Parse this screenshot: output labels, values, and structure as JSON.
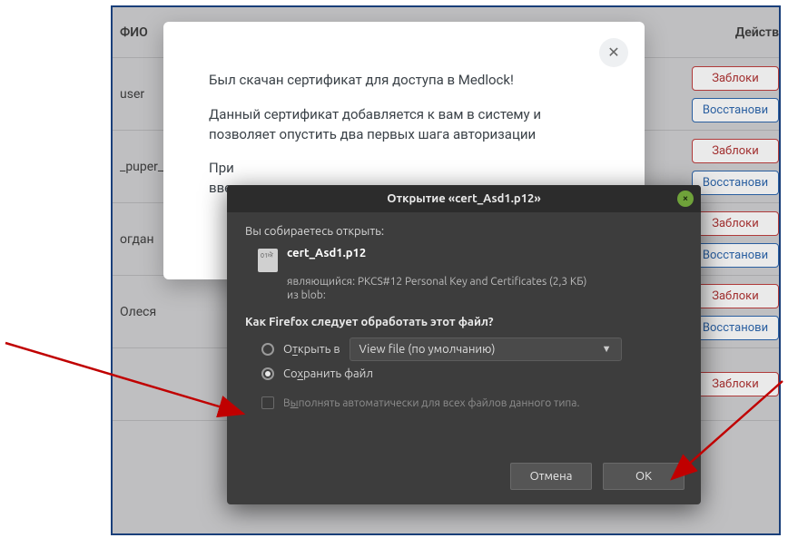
{
  "table": {
    "header_name": "ФИО",
    "header_actions": "Действ",
    "rows": [
      {
        "name": "user"
      },
      {
        "name": "_puper_"
      },
      {
        "name": "огдан"
      },
      {
        "name": "Олеся"
      }
    ],
    "block_label": "Заблоки",
    "restore_label": "Восстанови"
  },
  "modal": {
    "line1": "Был скачан сертификат для доступа в Medlock!",
    "line2": "Данный сертификат добавляется к вам в систему и позволяет опустить два первых шага авторизации",
    "line3_prefix": "При",
    "line4_prefix": "ввес"
  },
  "ff": {
    "title": "Открытие «cert_Asd1.p12»",
    "opening_label": "Вы собираетесь открыть:",
    "filename": "cert_Asd1.p12",
    "being_label": "являющийся:",
    "being_value": "PKCS#12 Personal Key and Certificates (2,3 КБ)",
    "from_label": "из",
    "from_value": "blob:",
    "question": "Как Firefox следует обработать этот файл?",
    "open_with_label_pre": "О",
    "open_with_label_u": "т",
    "open_with_label_post": "крыть в",
    "open_with_app": "View file (по умолчанию)",
    "save_label_pre": "Со",
    "save_label_u": "х",
    "save_label_post": "ранить файл",
    "auto_label_pre": "В",
    "auto_label_u": "ы",
    "auto_label_post": "полнять автоматически для всех файлов данного типа.",
    "cancel": "Отмена",
    "ok": "ОК"
  }
}
